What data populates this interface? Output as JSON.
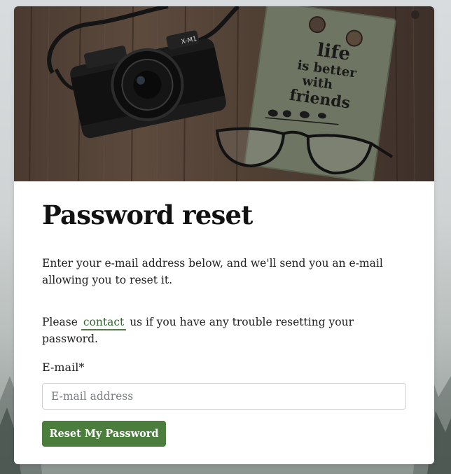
{
  "hero": {
    "notebook_text": [
      "life",
      "is better",
      "with",
      "friends"
    ],
    "camera_brand": "X-M1"
  },
  "page": {
    "title": "Password reset",
    "instructions": "Enter your e-mail address below, and we'll send you an e-mail allowing you to reset it.",
    "help_prefix": "Please",
    "contact_link": "contact",
    "help_suffix": "us if you have any trouble resetting your password."
  },
  "form": {
    "email_label": "E-mail*",
    "email_placeholder": "E-mail address",
    "email_value": "",
    "submit_label": "Reset My Password"
  },
  "colors": {
    "accent": "#4b7d3c",
    "link": "#2f6a2a"
  }
}
